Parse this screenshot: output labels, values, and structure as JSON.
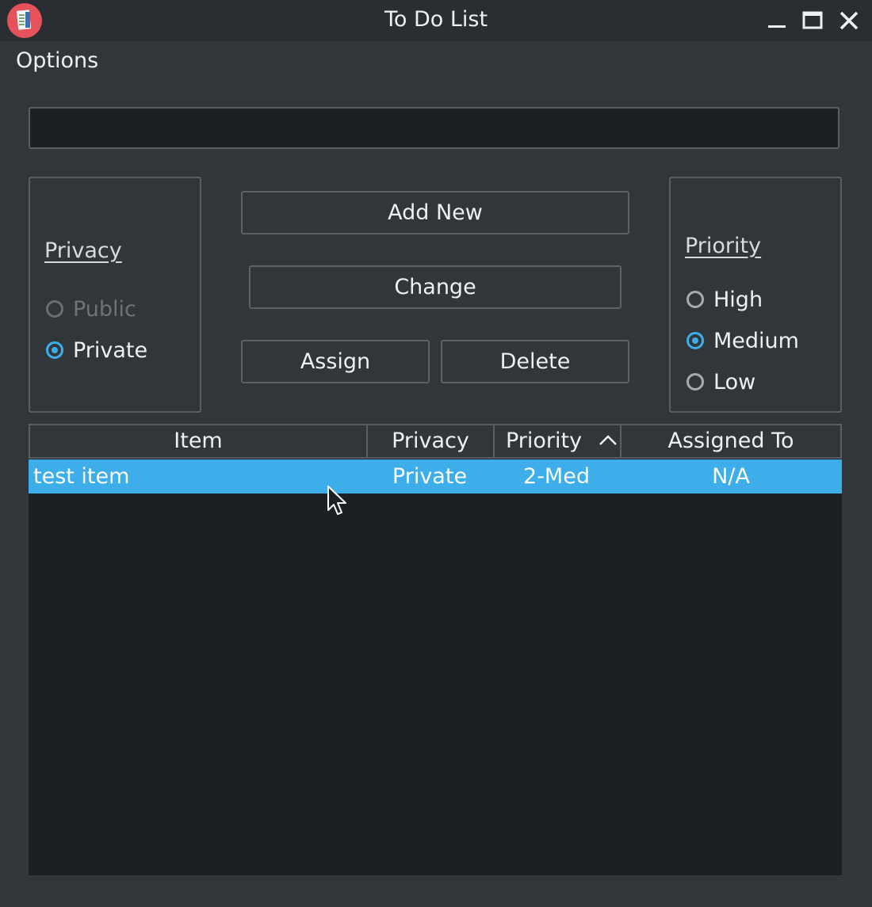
{
  "window": {
    "title": "To Do List"
  },
  "menu": {
    "options_label": "Options"
  },
  "entry": {
    "value": "",
    "placeholder": ""
  },
  "privacy_group": {
    "title": "Privacy",
    "options": [
      {
        "label": "Public",
        "checked": false,
        "enabled": false
      },
      {
        "label": "Private",
        "checked": true,
        "enabled": true
      }
    ]
  },
  "priority_group": {
    "title": "Priority",
    "options": [
      {
        "label": "High",
        "checked": false
      },
      {
        "label": "Medium",
        "checked": true
      },
      {
        "label": "Low",
        "checked": false
      }
    ]
  },
  "buttons": {
    "add_new": "Add New",
    "change": "Change",
    "assign": "Assign",
    "delete": "Delete"
  },
  "table": {
    "columns": [
      "Item",
      "Privacy",
      "Priority",
      "Assigned To"
    ],
    "sort_column": "Priority",
    "sort_direction": "ascending",
    "rows": [
      {
        "item": "test item",
        "privacy": "Private",
        "priority": "2-Med",
        "assigned_to": "N/A",
        "selected": true
      }
    ]
  },
  "colors": {
    "accent": "#3daee9",
    "background": "#31363b",
    "titlebar": "#2a2e32",
    "field": "#1d2023"
  }
}
